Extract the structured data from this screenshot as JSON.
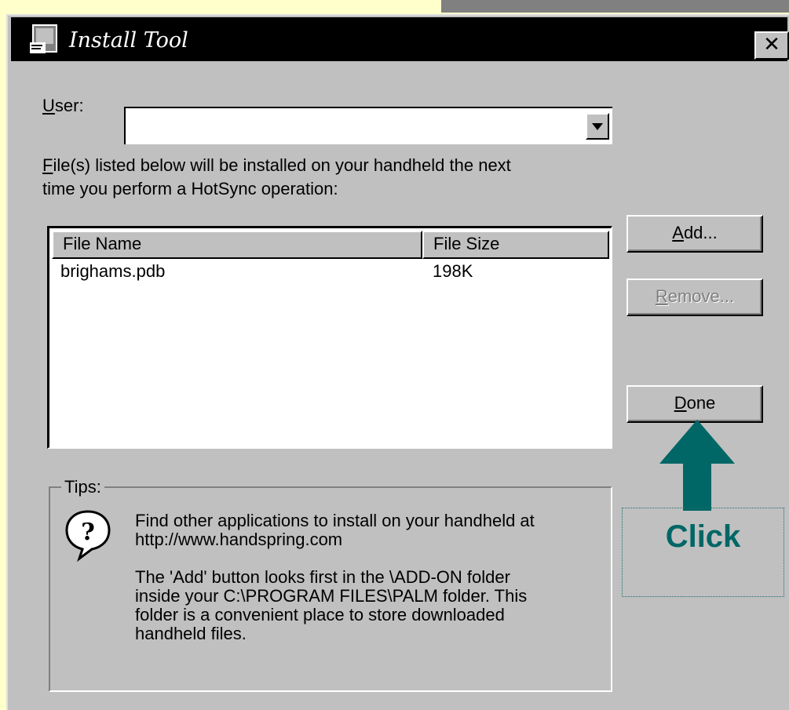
{
  "dialog": {
    "title": "Install Tool",
    "close_glyph": "✕",
    "user_label_mnemonic": "U",
    "user_label_rest": "ser:",
    "user_value": "",
    "instruction_mnemonic": "F",
    "instruction_line1_rest": "ile(s) listed below will be installed on your handheld the next",
    "instruction_line2": "time you perform a HotSync operation:"
  },
  "file_list": {
    "columns": [
      "File Name",
      "File Size"
    ],
    "rows": [
      {
        "name": "brighams.pdb",
        "size": "198K"
      }
    ]
  },
  "buttons": {
    "add": {
      "mnemonic": "A",
      "rest": "dd...",
      "enabled": true
    },
    "remove": {
      "mnemonic": "R",
      "rest": "emove...",
      "enabled": false
    },
    "done": {
      "mnemonic": "D",
      "rest": "one",
      "enabled": true
    }
  },
  "tips": {
    "legend": "Tips:",
    "icon": "help-question-icon",
    "para1_line1": "Find other applications to install on your handheld at",
    "para1_line2": "http://www.handspring.com",
    "para2_line1": "The 'Add' button looks first in the \\ADD-ON folder",
    "para2_line2": "inside your C:\\PROGRAM FILES\\PALM folder. This",
    "para2_line3": "folder is a convenient place to store downloaded",
    "para2_line4": "handheld files."
  },
  "annotation": {
    "label": "Click",
    "color": "#006666",
    "arrow_icon": "arrow-up-icon"
  },
  "colors": {
    "slide_background": "#ffffcc",
    "dialog_face": "#c0c0c0",
    "titlebar": "#000000"
  }
}
